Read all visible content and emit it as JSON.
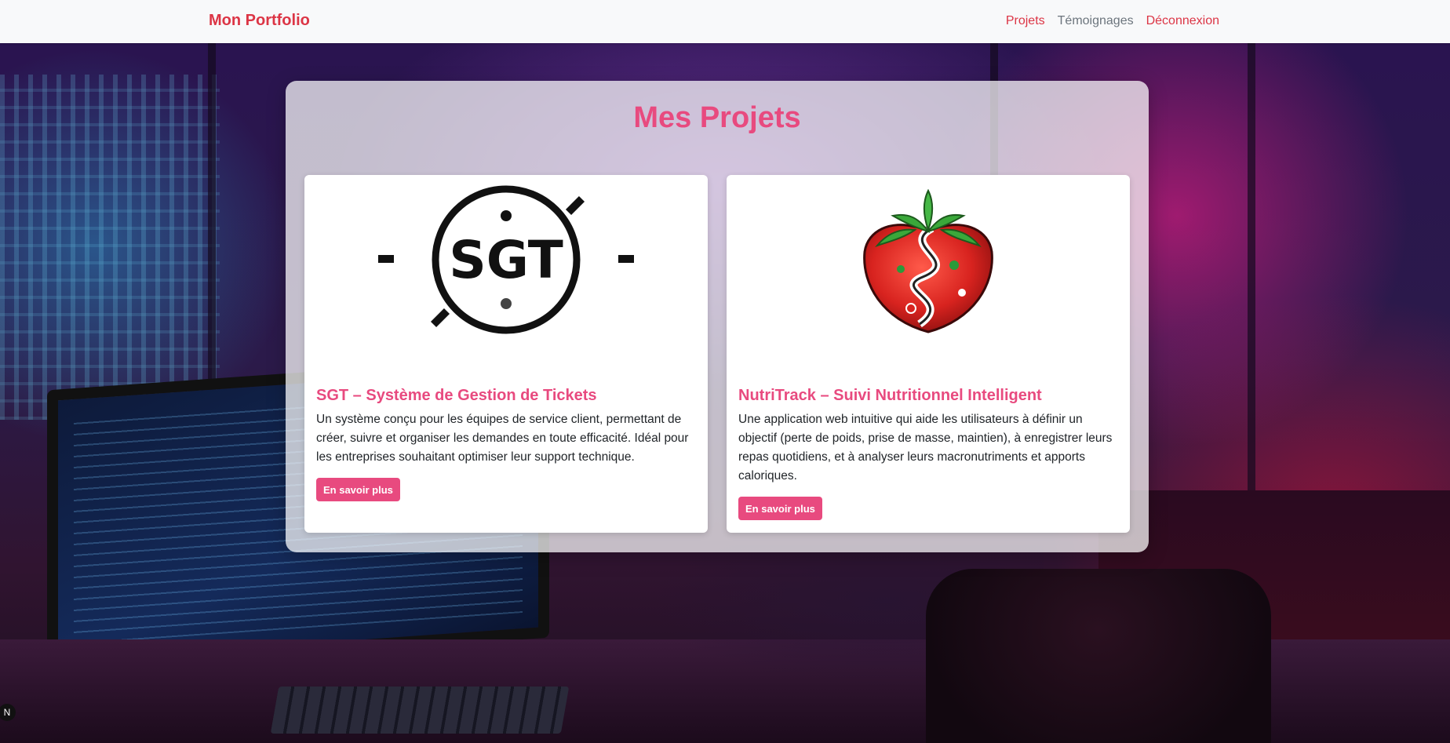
{
  "navbar": {
    "brand": "Mon Portfolio",
    "links": [
      {
        "label": "Projets",
        "active": true
      },
      {
        "label": "Témoignages",
        "active": false
      },
      {
        "label": "Déconnexion",
        "active": false
      }
    ]
  },
  "main": {
    "title": "Mes Projets",
    "projects": [
      {
        "logo_text": "SGT",
        "title": "SGT – Système de Gestion de Tickets",
        "description": "Un système conçu pour les équipes de service client, permettant de créer, suivre et organiser les demandes en toute efficacité. Idéal pour les entreprises souhaitant optimiser leur support technique.",
        "button": "En savoir plus"
      },
      {
        "logo_icon": "strawberry-logo-icon",
        "title": "NutriTrack – Suivi Nutritionnel Intelligent",
        "description": "Une application web intuitive qui aide les utilisateurs à définir un objectif (perte de poids, prise de masse, maintien), à enregistrer leurs repas quotidiens, et à analyser leurs macronutriments et apports caloriques.",
        "button": "En savoir plus"
      }
    ]
  },
  "corner_badge": "N",
  "colors": {
    "accent": "#e84a7f",
    "nav_accent": "#dc3545",
    "navbar_bg": "#f8f9fa"
  }
}
